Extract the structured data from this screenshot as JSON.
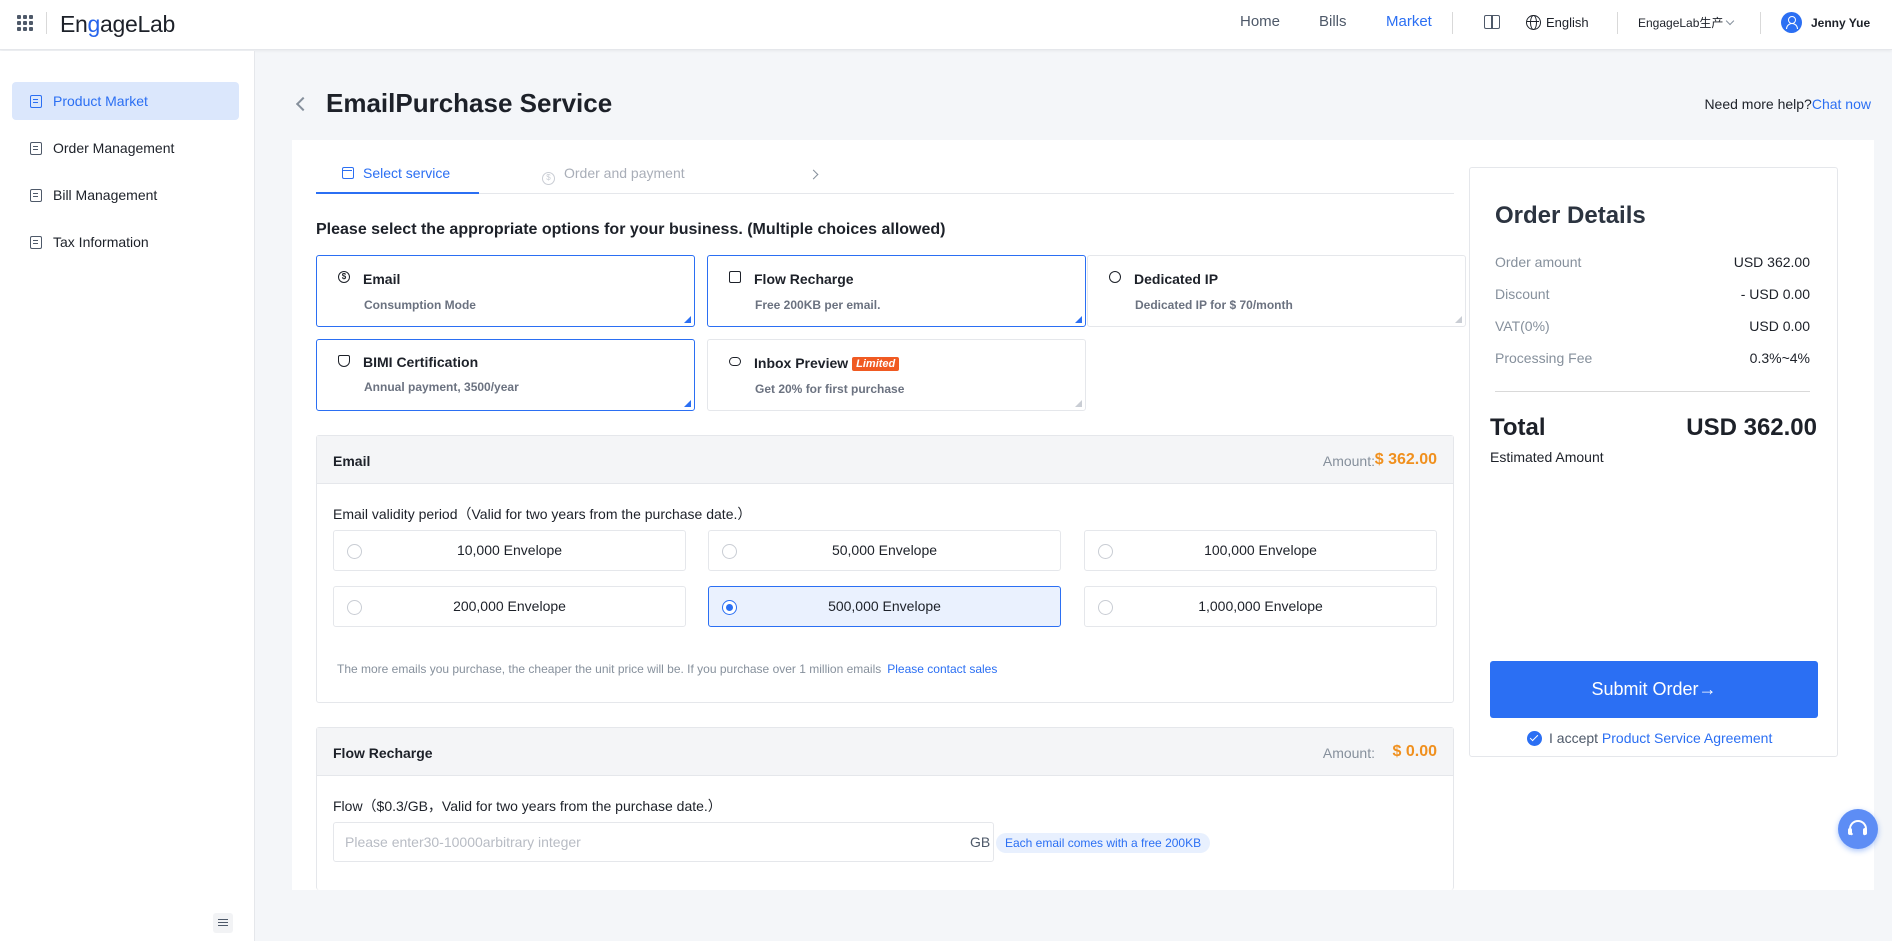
{
  "header": {
    "logo_text_1": "En",
    "logo_text_g": "g",
    "logo_text_2": "ageLab",
    "nav": [
      {
        "label": "Home"
      },
      {
        "label": "Bills"
      },
      {
        "label": "Market"
      }
    ],
    "language": "English",
    "org": "EngageLab生产",
    "user": "Jenny Yue"
  },
  "sidebar": {
    "items": [
      {
        "label": "Product Market"
      },
      {
        "label": "Order Management"
      },
      {
        "label": "Bill Management"
      },
      {
        "label": "Tax Information"
      }
    ]
  },
  "page": {
    "title": "EmailPurchase Service",
    "help_text": "Need more help?",
    "help_link": "Chat now"
  },
  "steps": [
    {
      "label": "Select service"
    },
    {
      "label": "Order and payment"
    }
  ],
  "select_title": "Please select the appropriate options for your business.  (Multiple choices allowed)",
  "options": [
    {
      "title": "Email",
      "sub": "Consumption Mode",
      "icon": "dollar-circle-icon"
    },
    {
      "title": "Flow Recharge",
      "sub": "Free 200KB per email.",
      "icon": "chart-icon"
    },
    {
      "title": "Dedicated IP",
      "sub": "Dedicated IP for $ 70/month",
      "icon": "globe-icon"
    },
    {
      "title": "BIMI Certification",
      "sub": "Annual payment, 3500/year",
      "icon": "shield-icon"
    },
    {
      "title": "Inbox Preview",
      "sub": "Get 20% for first purchase",
      "badge": "Limited",
      "icon": "eye-icon"
    }
  ],
  "email_section": {
    "title": "Email",
    "amount_label": "Amount:",
    "amount": "$ 362.00",
    "validity_label": "Email validity period（Valid for two years from the purchase date.）",
    "envelopes": [
      {
        "label": "10,000 Envelope"
      },
      {
        "label": "50,000 Envelope"
      },
      {
        "label": "100,000 Envelope"
      },
      {
        "label": "200,000 Envelope"
      },
      {
        "label": "500,000 Envelope"
      },
      {
        "label": "1,000,000 Envelope"
      }
    ],
    "note": "The more emails you purchase, the cheaper the unit price will be. If you purchase over 1 million emails",
    "note_link": "Please contact sales"
  },
  "flow_section": {
    "title": "Flow Recharge",
    "amount_label": "Amount:",
    "amount": "$ 0.00",
    "field_label": "Flow（$0.3/GB，Valid for two years from the purchase date.）",
    "placeholder": "Please enter30-10000arbitrary integer",
    "unit": "GB",
    "free_tag": "Each email comes with a free 200KB"
  },
  "order": {
    "title": "Order Details",
    "rows": [
      {
        "k": "Order amount",
        "v": "USD 362.00"
      },
      {
        "k": "Discount",
        "v": "- USD 0.00"
      },
      {
        "k": "VAT(0%)",
        "v": "USD 0.00"
      },
      {
        "k": "Processing Fee",
        "v": "0.3%~4%"
      }
    ],
    "total_label": "Total",
    "total_value": "USD 362.00",
    "estimated": "Estimated Amount",
    "submit": "Submit Order→",
    "accept_text": "I accept",
    "accept_link": "Product Service Agreement"
  }
}
